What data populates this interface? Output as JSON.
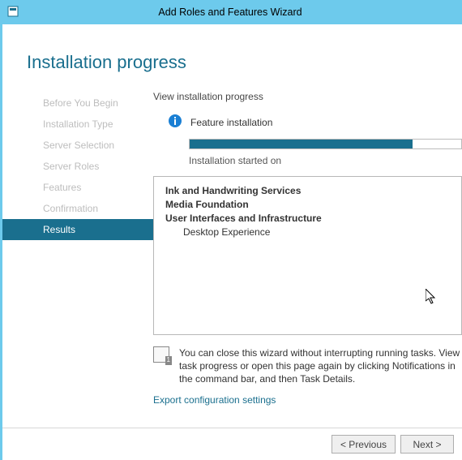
{
  "titlebar": {
    "title": "Add Roles and Features Wizard"
  },
  "heading": "Installation progress",
  "nav": {
    "items": [
      {
        "label": "Before You Begin"
      },
      {
        "label": "Installation Type"
      },
      {
        "label": "Server Selection"
      },
      {
        "label": "Server Roles"
      },
      {
        "label": "Features"
      },
      {
        "label": "Confirmation"
      },
      {
        "label": "Results"
      }
    ],
    "active_index": 6
  },
  "main": {
    "section_label": "View installation progress",
    "feature_label": "Feature installation",
    "progress_text": "Installation started on",
    "features": {
      "line0": "Ink and Handwriting Services",
      "line1": "Media Foundation",
      "line2": "User Interfaces and Infrastructure",
      "sub0": "Desktop Experience"
    },
    "tip": "You can close this wizard without interrupting running tasks. View task progress or open this page again by clicking Notifications in the command bar, and then Task Details.",
    "link": "Export configuration settings"
  },
  "buttons": {
    "previous": "< Previous",
    "next": "Next >"
  }
}
